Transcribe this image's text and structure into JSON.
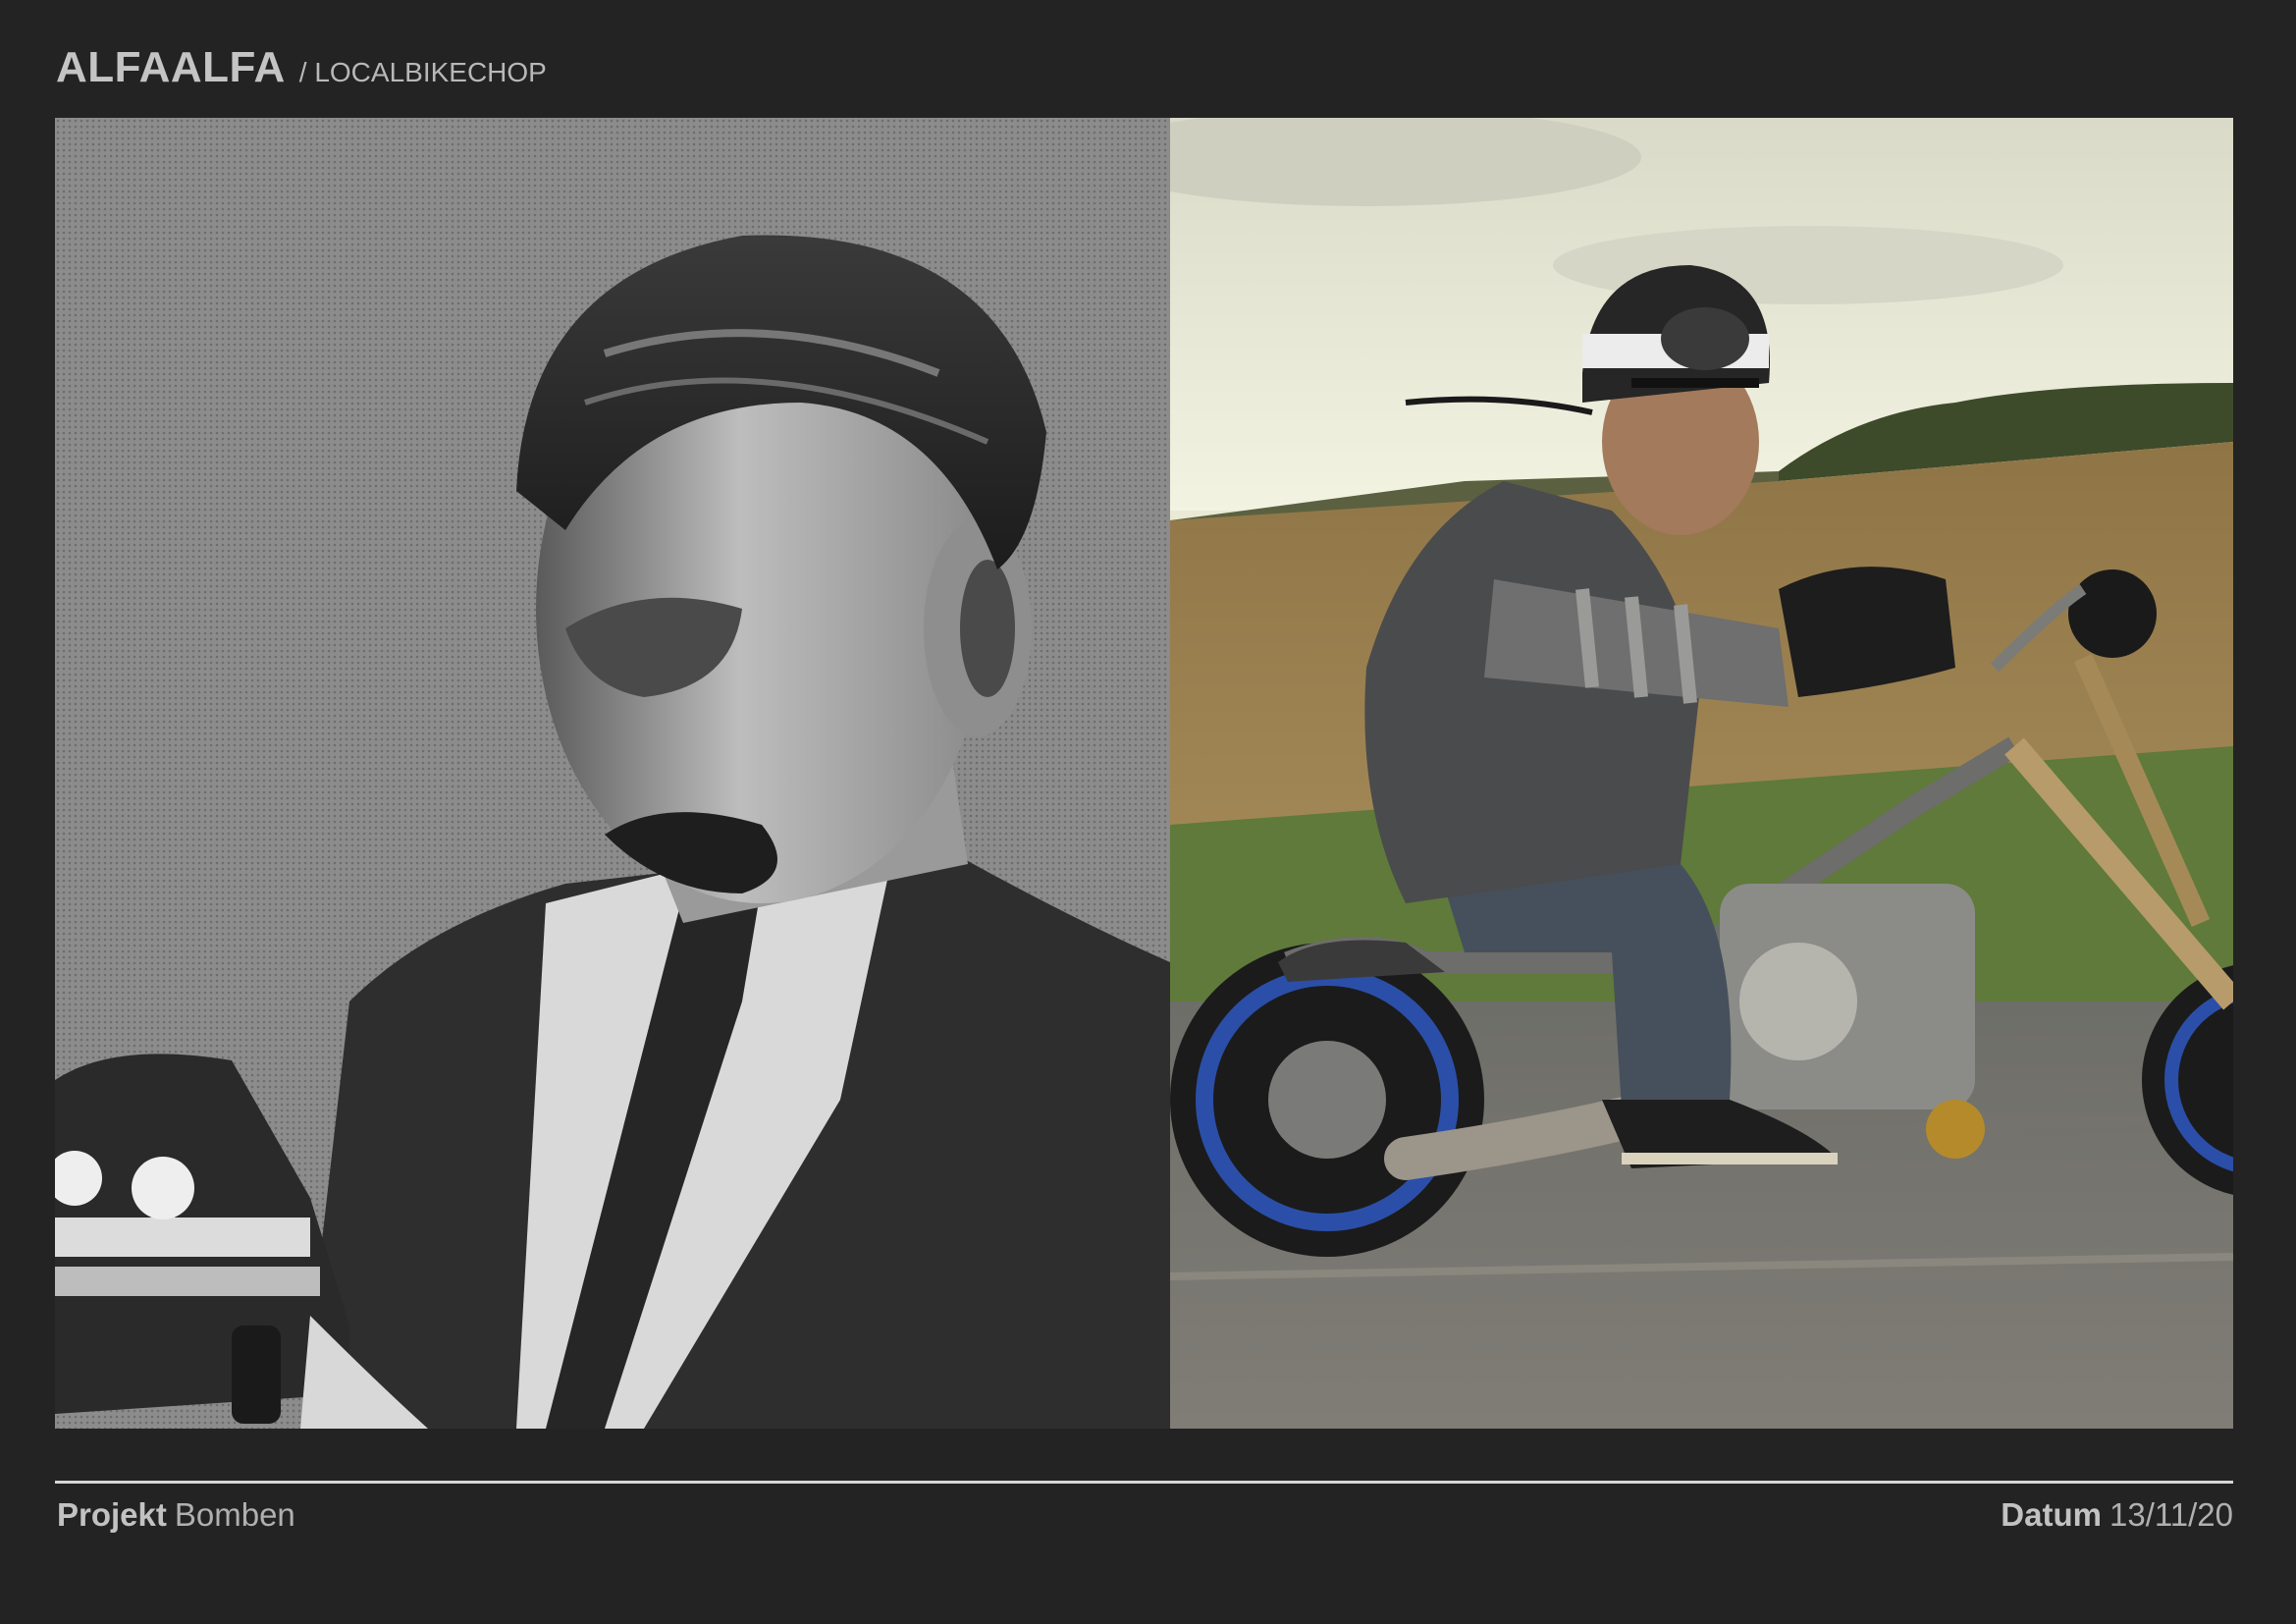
{
  "header": {
    "brand": "ALFAALFA",
    "client": "/ LOCALBIKECHOP"
  },
  "footer": {
    "project_label": "Projekt",
    "project_value": "Bomben",
    "date_label": "Datum",
    "date_value": "13/11/20"
  }
}
